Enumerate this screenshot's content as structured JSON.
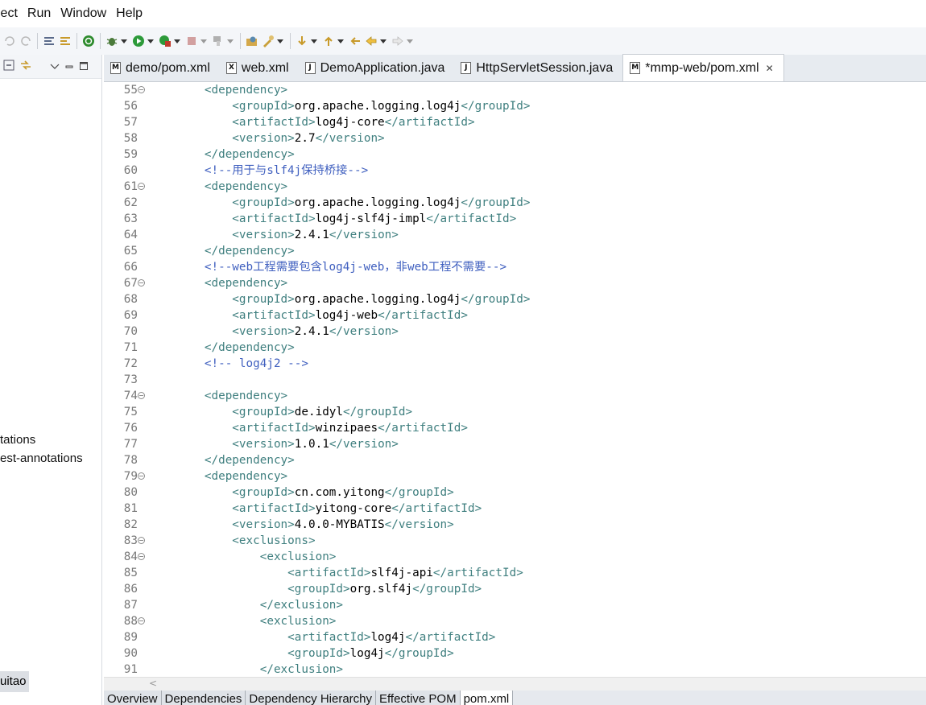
{
  "menu": [
    "ject",
    "Run",
    "Window",
    "Help"
  ],
  "tabs": [
    {
      "label": "demo/pom.xml",
      "icon": "M",
      "active": false
    },
    {
      "label": "web.xml",
      "icon": "X",
      "active": false
    },
    {
      "label": "DemoApplication.java",
      "icon": "J",
      "active": false
    },
    {
      "label": "HttpServletSession.java",
      "icon": "J",
      "active": false
    },
    {
      "label": "*mmp-web/pom.xml",
      "icon": "M",
      "active": true
    }
  ],
  "left_items": [
    "tations",
    "est-annotations"
  ],
  "left_bottom": "uitao",
  "code": [
    {
      "n": "55",
      "fold": true,
      "ind": 2,
      "t": [
        [
          "tag",
          "<dependency>"
        ]
      ]
    },
    {
      "n": "56",
      "fold": false,
      "ind": 3,
      "t": [
        [
          "tag",
          "<groupId>"
        ],
        [
          "txt",
          "org.apache.logging.log4j"
        ],
        [
          "tag",
          "</groupId>"
        ]
      ]
    },
    {
      "n": "57",
      "fold": false,
      "ind": 3,
      "t": [
        [
          "tag",
          "<artifactId>"
        ],
        [
          "txt",
          "log4j-core"
        ],
        [
          "tag",
          "</artifactId>"
        ]
      ]
    },
    {
      "n": "58",
      "fold": false,
      "ind": 3,
      "t": [
        [
          "tag",
          "<version>"
        ],
        [
          "txt",
          "2.7"
        ],
        [
          "tag",
          "</version>"
        ]
      ]
    },
    {
      "n": "59",
      "fold": false,
      "ind": 2,
      "t": [
        [
          "tag",
          "</dependency>"
        ]
      ]
    },
    {
      "n": "60",
      "fold": false,
      "ind": 2,
      "t": [
        [
          "cmt",
          "<!--用于与slf4j保持桥接-->"
        ]
      ]
    },
    {
      "n": "61",
      "fold": true,
      "ind": 2,
      "t": [
        [
          "tag",
          "<dependency>"
        ]
      ]
    },
    {
      "n": "62",
      "fold": false,
      "ind": 3,
      "t": [
        [
          "tag",
          "<groupId>"
        ],
        [
          "txt",
          "org.apache.logging.log4j"
        ],
        [
          "tag",
          "</groupId>"
        ]
      ]
    },
    {
      "n": "63",
      "fold": false,
      "ind": 3,
      "t": [
        [
          "tag",
          "<artifactId>"
        ],
        [
          "txt",
          "log4j-slf4j-impl"
        ],
        [
          "tag",
          "</artifactId>"
        ]
      ]
    },
    {
      "n": "64",
      "fold": false,
      "ind": 3,
      "t": [
        [
          "tag",
          "<version>"
        ],
        [
          "txt",
          "2.4.1"
        ],
        [
          "tag",
          "</version>"
        ]
      ]
    },
    {
      "n": "65",
      "fold": false,
      "ind": 2,
      "t": [
        [
          "tag",
          "</dependency>"
        ]
      ]
    },
    {
      "n": "66",
      "fold": false,
      "ind": 2,
      "t": [
        [
          "cmt",
          "<!--web工程需要包含log4j-web，非web工程不需要-->"
        ]
      ]
    },
    {
      "n": "67",
      "fold": true,
      "ind": 2,
      "t": [
        [
          "tag",
          "<dependency>"
        ]
      ]
    },
    {
      "n": "68",
      "fold": false,
      "ind": 3,
      "t": [
        [
          "tag",
          "<groupId>"
        ],
        [
          "txt",
          "org.apache.logging.log4j"
        ],
        [
          "tag",
          "</groupId>"
        ]
      ]
    },
    {
      "n": "69",
      "fold": false,
      "ind": 3,
      "t": [
        [
          "tag",
          "<artifactId>"
        ],
        [
          "txt",
          "log4j-web"
        ],
        [
          "tag",
          "</artifactId>"
        ]
      ]
    },
    {
      "n": "70",
      "fold": false,
      "ind": 3,
      "t": [
        [
          "tag",
          "<version>"
        ],
        [
          "txt",
          "2.4.1"
        ],
        [
          "tag",
          "</version>"
        ]
      ]
    },
    {
      "n": "71",
      "fold": false,
      "ind": 2,
      "t": [
        [
          "tag",
          "</dependency>"
        ]
      ]
    },
    {
      "n": "72",
      "fold": false,
      "ind": 2,
      "t": [
        [
          "cmt",
          "<!-- log4j2 -->"
        ]
      ]
    },
    {
      "n": "73",
      "fold": false,
      "ind": 0,
      "t": []
    },
    {
      "n": "74",
      "fold": true,
      "ind": 2,
      "t": [
        [
          "tag",
          "<dependency>"
        ]
      ]
    },
    {
      "n": "75",
      "fold": false,
      "ind": 3,
      "t": [
        [
          "tag",
          "<groupId>"
        ],
        [
          "txt",
          "de.idyl"
        ],
        [
          "tag",
          "</groupId>"
        ]
      ]
    },
    {
      "n": "76",
      "fold": false,
      "ind": 3,
      "t": [
        [
          "tag",
          "<artifactId>"
        ],
        [
          "txt",
          "winzipaes"
        ],
        [
          "tag",
          "</artifactId>"
        ]
      ]
    },
    {
      "n": "77",
      "fold": false,
      "ind": 3,
      "t": [
        [
          "tag",
          "<version>"
        ],
        [
          "txt",
          "1.0.1"
        ],
        [
          "tag",
          "</version>"
        ]
      ]
    },
    {
      "n": "78",
      "fold": false,
      "ind": 2,
      "t": [
        [
          "tag",
          "</dependency>"
        ]
      ]
    },
    {
      "n": "79",
      "fold": true,
      "ind": 2,
      "t": [
        [
          "tag",
          "<dependency>"
        ]
      ]
    },
    {
      "n": "80",
      "fold": false,
      "ind": 3,
      "t": [
        [
          "tag",
          "<groupId>"
        ],
        [
          "txt",
          "cn.com.yitong"
        ],
        [
          "tag",
          "</groupId>"
        ]
      ]
    },
    {
      "n": "81",
      "fold": false,
      "ind": 3,
      "t": [
        [
          "tag",
          "<artifactId>"
        ],
        [
          "txt",
          "yitong-core"
        ],
        [
          "tag",
          "</artifactId>"
        ]
      ]
    },
    {
      "n": "82",
      "fold": false,
      "ind": 3,
      "t": [
        [
          "tag",
          "<version>"
        ],
        [
          "txt",
          "4.0.0-MYBATIS"
        ],
        [
          "tag",
          "</version>"
        ]
      ]
    },
    {
      "n": "83",
      "fold": true,
      "ind": 3,
      "t": [
        [
          "tag",
          "<exclusions>"
        ]
      ]
    },
    {
      "n": "84",
      "fold": true,
      "ind": 4,
      "t": [
        [
          "tag",
          "<exclusion>"
        ]
      ]
    },
    {
      "n": "85",
      "fold": false,
      "ind": 5,
      "t": [
        [
          "tag",
          "<artifactId>"
        ],
        [
          "txt",
          "slf4j-api"
        ],
        [
          "tag",
          "</artifactId>"
        ]
      ]
    },
    {
      "n": "86",
      "fold": false,
      "ind": 5,
      "t": [
        [
          "tag",
          "<groupId>"
        ],
        [
          "txt",
          "org.slf4j"
        ],
        [
          "tag",
          "</groupId>"
        ]
      ]
    },
    {
      "n": "87",
      "fold": false,
      "ind": 4,
      "t": [
        [
          "tag",
          "</exclusion>"
        ]
      ]
    },
    {
      "n": "88",
      "fold": true,
      "ind": 4,
      "t": [
        [
          "tag",
          "<exclusion>"
        ]
      ]
    },
    {
      "n": "89",
      "fold": false,
      "ind": 5,
      "t": [
        [
          "tag",
          "<artifactId>"
        ],
        [
          "txt",
          "log4j"
        ],
        [
          "tag",
          "</artifactId>"
        ]
      ]
    },
    {
      "n": "90",
      "fold": false,
      "ind": 5,
      "t": [
        [
          "tag",
          "<groupId>"
        ],
        [
          "txt",
          "log4j"
        ],
        [
          "tag",
          "</groupId>"
        ]
      ]
    },
    {
      "n": "91",
      "fold": false,
      "ind": 4,
      "t": [
        [
          "tag",
          "</exclusion>"
        ]
      ]
    }
  ],
  "page_tabs": [
    {
      "label": "Overview",
      "active": false
    },
    {
      "label": "Dependencies",
      "active": false
    },
    {
      "label": "Dependency Hierarchy",
      "active": false
    },
    {
      "label": "Effective POM",
      "active": false
    },
    {
      "label": "pom.xml",
      "active": true
    }
  ],
  "colors": {
    "tag": "#3f7f7f",
    "comment": "#3f5fbf",
    "text": "#000000",
    "line_number": "#787878"
  }
}
